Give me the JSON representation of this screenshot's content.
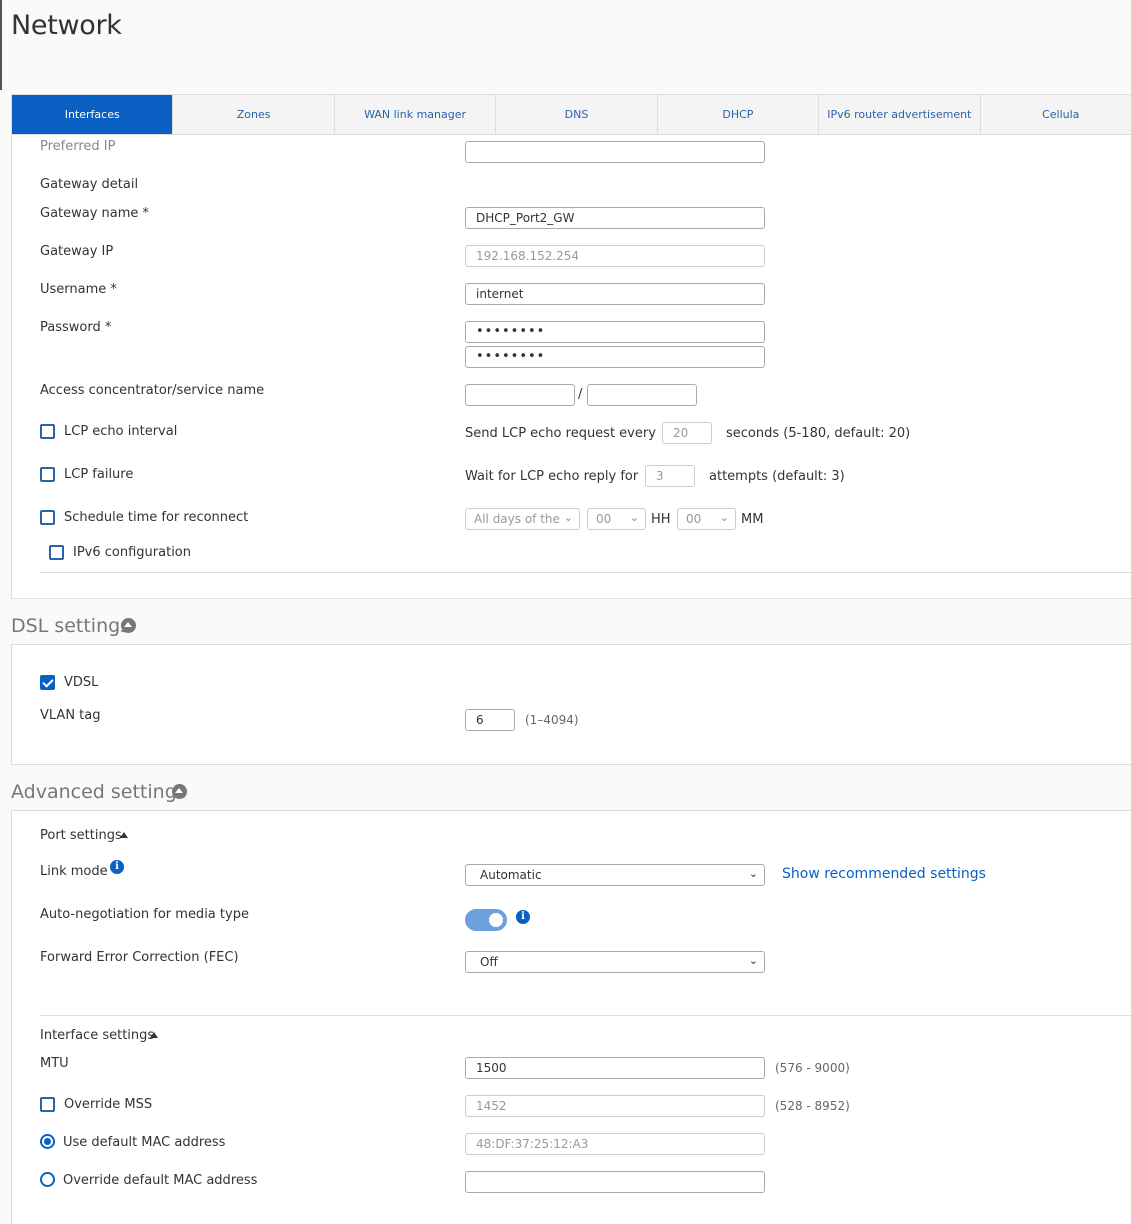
{
  "page": {
    "title": "Network"
  },
  "tabs": [
    {
      "label": "Interfaces",
      "active": true
    },
    {
      "label": "Zones"
    },
    {
      "label": "WAN link manager"
    },
    {
      "label": "DNS"
    },
    {
      "label": "DHCP"
    },
    {
      "label": "IPv6 router advertisement"
    },
    {
      "label": "Cellula"
    }
  ],
  "gateway": {
    "preferred_ip_label": "Preferred IP",
    "preferred_ip_value": "",
    "detail_heading": "Gateway detail",
    "name_label": "Gateway name *",
    "name_value": "DHCP_Port2_GW",
    "ip_label": "Gateway IP",
    "ip_value": "192.168.152.254"
  },
  "pppoe": {
    "username_label": "Username *",
    "username_value": "internet",
    "password_label": "Password *",
    "password_value": "••••••••",
    "password_confirm_value": "••••••••",
    "access_label": "Access concentrator/service name",
    "access_separator": "/",
    "lcp_echo_label": "LCP echo interval",
    "lcp_echo_text": "Send LCP echo request every",
    "lcp_echo_value": "20",
    "lcp_echo_hint": "seconds (5-180, default: 20)",
    "lcp_failure_label": "LCP failure",
    "lcp_failure_text": "Wait for LCP echo reply for",
    "lcp_failure_value": "3",
    "lcp_failure_hint": "attempts (default: 3)",
    "schedule_label": "Schedule time for reconnect",
    "schedule_days": "All days of the",
    "schedule_hh": "00",
    "schedule_hh_unit": "HH",
    "schedule_mm": "00",
    "schedule_mm_unit": "MM",
    "ipv6_label": "IPv6 configuration"
  },
  "dsl": {
    "title": "DSL settings",
    "vdsl_label": "VDSL",
    "vdsl_checked": true,
    "vlan_label": "VLAN tag",
    "vlan_value": "6",
    "vlan_hint": "(1–4094)"
  },
  "advanced": {
    "title": "Advanced settings",
    "port_heading": "Port settings",
    "link_mode_label": "Link mode",
    "link_mode_value": "Automatic",
    "show_recommended": "Show recommended settings",
    "autoneg_label": "Auto-negotiation for media type",
    "autoneg_on": true,
    "fec_label": "Forward Error Correction (FEC)",
    "fec_value": "Off",
    "interface_heading": "Interface settings",
    "mtu_label": "MTU",
    "mtu_value": "1500",
    "mtu_hint": "(576 - 9000)",
    "mss_label": "Override MSS",
    "mss_value": "1452",
    "mss_hint": "(528 - 8952)",
    "default_mac_label": "Use default MAC address",
    "default_mac_value": "48:DF:37:25:12:A3",
    "override_mac_label": "Override default MAC address",
    "override_mac_value": ""
  },
  "colors": {
    "accent": "#0a5fc3",
    "link": "#2a63a8",
    "toggle": "#6fa0de"
  }
}
